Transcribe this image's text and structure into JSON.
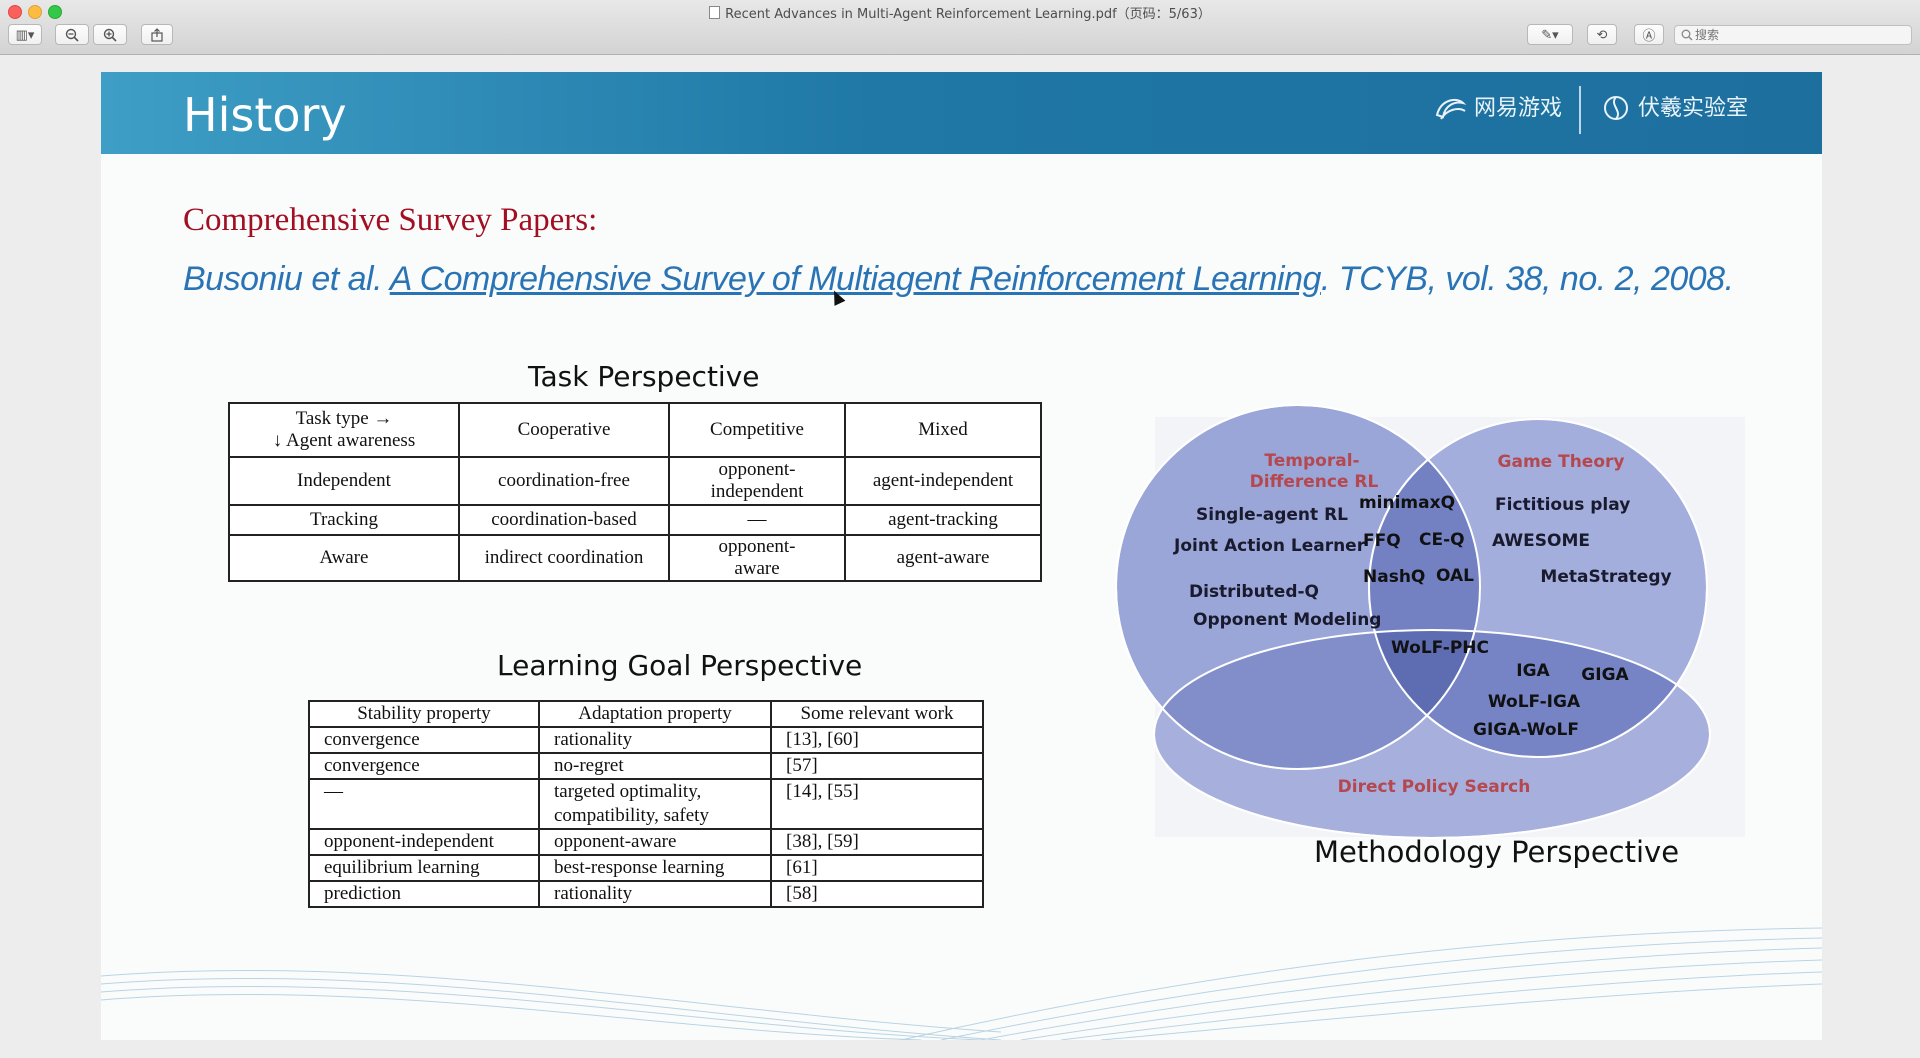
{
  "window": {
    "title": "Recent Advances in Multi-Agent Reinforcement Learning.pdf（页码：5/63）",
    "search_placeholder": "搜索"
  },
  "toolbar": {
    "sidebar_label": "▥▾",
    "zoom_out_label": "−",
    "zoom_in_label": "+",
    "share_label": "⇪",
    "markup_label": "✎▾",
    "rotate_label": "⟲",
    "annotate_label": "Ⓐ"
  },
  "slide": {
    "title": "History",
    "logo_left": "网易游戏",
    "logo_right": "伏羲实验室",
    "survey_heading": "Comprehensive Survey Papers:",
    "citation": {
      "authors": "Busoniu et al. ",
      "paper_title": "A Comprehensive Survey of Multiagent Reinforcement Learning",
      "venue": ". TCYB, vol. 38, no. 2, 2008."
    }
  },
  "task_perspective": {
    "title": "Task Perspective",
    "header_line1": "Task type →",
    "header_line2": "↓ Agent awareness",
    "columns": [
      "Cooperative",
      "Competitive",
      "Mixed"
    ],
    "rows": [
      {
        "label": "Independent",
        "cells": [
          "coordination-free",
          "opponent-independent",
          "agent-independent"
        ]
      },
      {
        "label": "Tracking",
        "cells": [
          "coordination-based",
          "—",
          "agent-tracking"
        ]
      },
      {
        "label": "Aware",
        "cells": [
          "indirect coordination",
          "opponent-aware",
          "agent-aware"
        ]
      }
    ]
  },
  "learning_goal": {
    "title": "Learning Goal Perspective",
    "columns": [
      "Stability property",
      "Adaptation property",
      "Some relevant work"
    ],
    "rows": [
      [
        "convergence",
        "rationality",
        "[13], [60]"
      ],
      [
        "convergence",
        "no-regret",
        "[57]"
      ],
      [
        "—",
        "targeted optimality, compatibility, safety",
        "[14], [55]"
      ],
      [
        "opponent-independent",
        "opponent-aware",
        "[38], [59]"
      ],
      [
        "equilibrium learning",
        "best-response learning",
        "[61]"
      ],
      [
        "prediction",
        "rationality",
        "[58]"
      ]
    ]
  },
  "methodology": {
    "title": "Methodology Perspective",
    "td_label_1": "Temporal-",
    "td_label_2": "Difference RL",
    "gt_label": "Game Theory",
    "dps_label": "Direct Policy Search",
    "td_only": [
      "Single-agent RL",
      "Joint Action Learner",
      "Distributed-Q",
      "Opponent Modeling"
    ],
    "td_gt": [
      "minimaxQ",
      "FFQ",
      "CE-Q",
      "NashQ",
      "OAL"
    ],
    "gt_only": [
      "Fictitious play",
      "AWESOME",
      "MetaStrategy"
    ],
    "all_three": "WoLF-PHC",
    "gt_dps": [
      "IGA",
      "GIGA",
      "WoLF-IGA",
      "GIGA-WoLF"
    ],
    "colors": {
      "label": "#b5474f",
      "circle": "#8c9bd0",
      "overlap": "#5c6ab0"
    }
  }
}
